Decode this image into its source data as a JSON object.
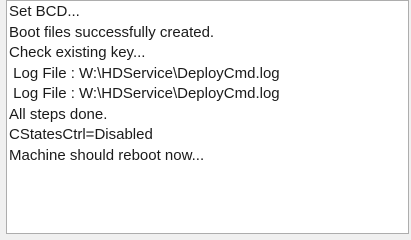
{
  "log": {
    "lines": [
      "Set BCD...",
      "Boot files successfully created.",
      "Check existing key...",
      " Log File : W:\\HDService\\DeployCmd.log",
      " Log File : W:\\HDService\\DeployCmd.log",
      "All steps done.",
      "CStatesCtrl=Disabled",
      "Machine should reboot now..."
    ]
  },
  "colors": {
    "text": "#1a1a1a",
    "background": "#ffffff",
    "border": "#adadad",
    "window": "#f0f0f0"
  }
}
